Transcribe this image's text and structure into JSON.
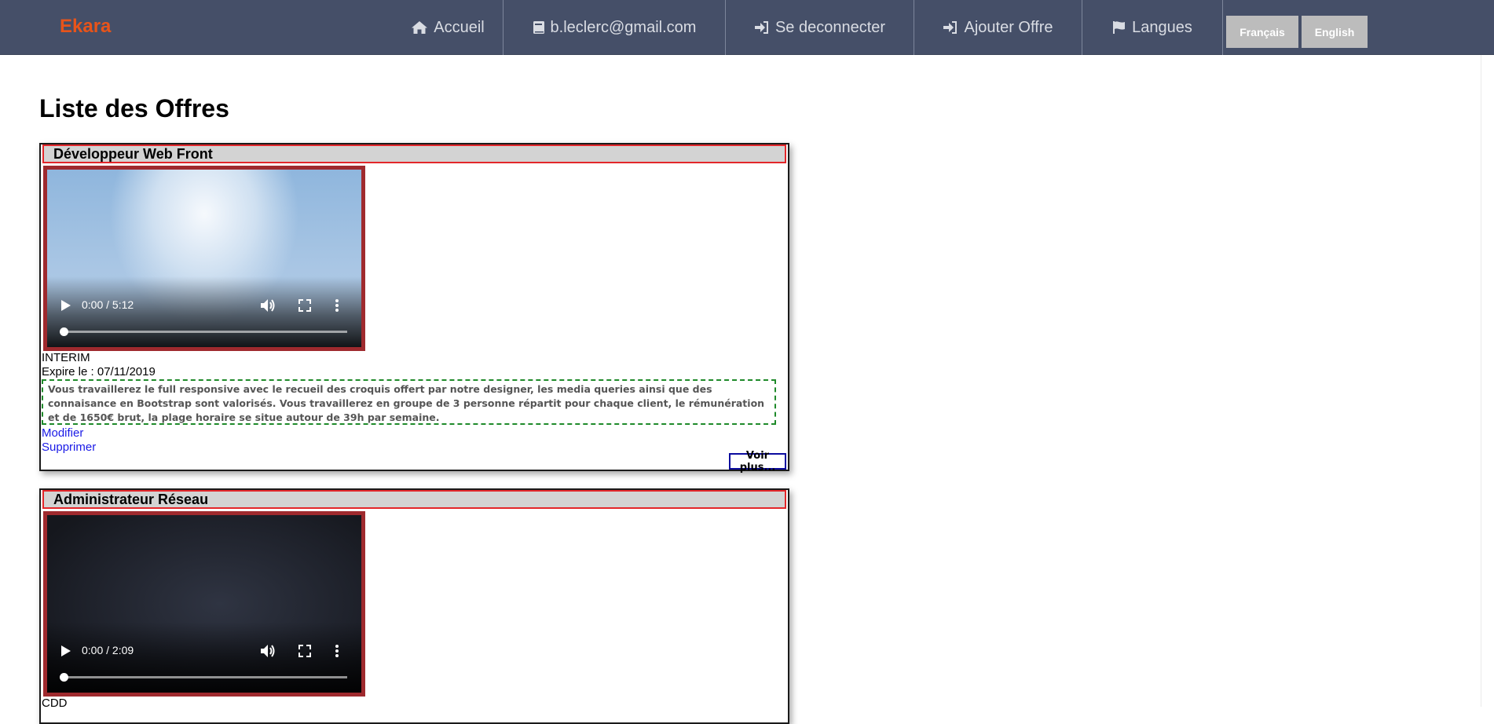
{
  "navbar": {
    "brand": "Ekara",
    "items": [
      {
        "label": "Accueil",
        "icon": "home-icon"
      },
      {
        "label": "b.leclerc@gmail.com",
        "icon": "book-icon"
      },
      {
        "label": "Se deconnecter",
        "icon": "sign-in-icon"
      },
      {
        "label": "Ajouter Offre",
        "icon": "sign-in-icon"
      },
      {
        "label": "Langues",
        "icon": "flag-icon"
      }
    ],
    "languages": [
      "Français",
      "English"
    ]
  },
  "page": {
    "title": "Liste des Offres"
  },
  "offers": [
    {
      "title": "Développeur Web Front",
      "video_time": "0:00 / 5:12",
      "contract": "INTERIM",
      "expire": "Expire le : 07/11/2019",
      "description": "Vous travaillerez le full responsive avec le recueil des croquis offert par notre designer, les media queries ainsi que des connaisance en Bootstrap sont valorisés. Vous travaillerez en groupe de 3 personne répartit pour chaque client, le rémunération et de 1650€ brut, la plage horaire se situe autour de 39h par semaine.",
      "edit_label": "Modifier",
      "delete_label": "Supprimer",
      "more_label": "Voir plus..."
    },
    {
      "title": "Administrateur Réseau",
      "video_time": "0:00 / 2:09",
      "contract": "CDD"
    }
  ],
  "colors": {
    "navbar_bg": "#454f68",
    "brand": "#e8541a",
    "card_header_border": "#e3262a",
    "video_border": "#9f2a2e",
    "description_border": "#1f8a2a",
    "link": "#1a1ae6"
  }
}
